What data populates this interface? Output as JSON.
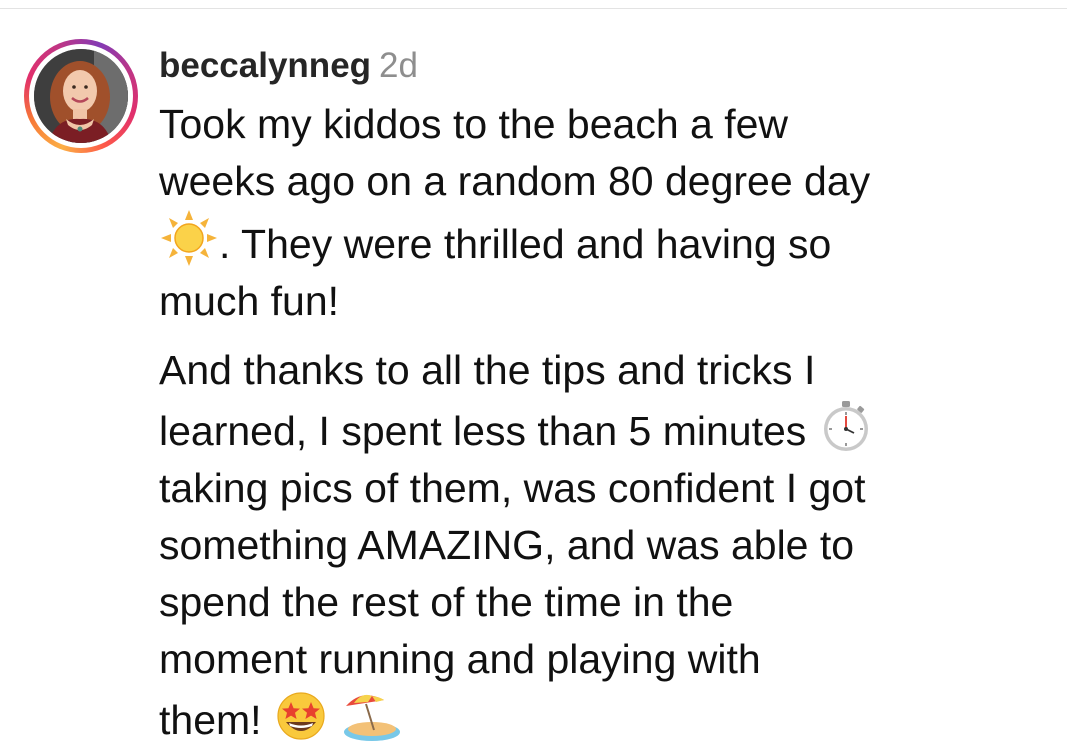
{
  "comment": {
    "username": "beccalynneg",
    "timestamp": "2d",
    "paragraph1": {
      "line1": "Took my kiddos to the beach a few",
      "line2": "weeks ago on a random 80 degree day",
      "line3_after_sun": ". They were thrilled and having so",
      "line4": "much fun!"
    },
    "paragraph2": {
      "line1": "And thanks to all the tips and tricks I",
      "line2": "learned, I spent less than 5 minutes",
      "line3": "taking pics of them, was confident I got",
      "line4": "something AMAZING, and was able to",
      "line5": "spend the rest of the time in the",
      "line6": "moment running and playing with",
      "line7": "them!"
    },
    "emojis": [
      "sun-icon",
      "stopwatch-icon",
      "star-struck-icon",
      "beach-umbrella-icon"
    ]
  },
  "colors": {
    "username": "#262626",
    "timestamp": "#8e8e8e",
    "story_ring": [
      "#fcaf45",
      "#e1306c",
      "#833ab4"
    ]
  }
}
